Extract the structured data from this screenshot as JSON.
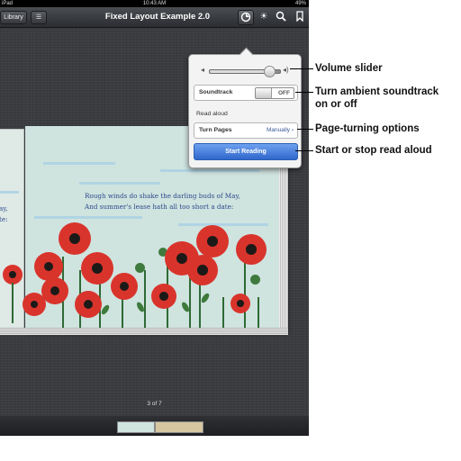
{
  "status_bar": {
    "device": "iPad",
    "wifi_icon": "wifi-icon",
    "time": "10:43 AM",
    "battery": "49%"
  },
  "toolbar": {
    "library_label": "Library",
    "toc_icon": "list-icon",
    "title": "Fixed Layout Example 2.0",
    "audio_icon": "audio-options-icon",
    "brightness_icon": "brightness-icon",
    "search_icon": "search-icon",
    "bookmark_icon": "bookmark-icon"
  },
  "page": {
    "poem_line1": "Rough winds do shake the darling buds of May,",
    "poem_line2": "And summer's lease hath all too short a date:",
    "left_page_fragment_1": "ay,",
    "left_page_fragment_2": "te:",
    "page_indicator": "3 of 7"
  },
  "popover": {
    "volume_level": 0.85,
    "soundtrack_label": "Soundtrack",
    "soundtrack_state": "OFF",
    "read_aloud_heading": "Read aloud",
    "turn_pages_label": "Turn Pages",
    "turn_pages_value": "Manually",
    "start_button": "Start Reading"
  },
  "callouts": {
    "volume": "Volume slider",
    "soundtrack_1": "Turn ambient soundtrack",
    "soundtrack_2": "on or off",
    "page_turning": "Page-turning options",
    "read_aloud": "Start or stop read aloud"
  },
  "colors": {
    "accent": "#2f67cc",
    "poppy": "#d9342c",
    "text_blue": "#2e4b8c"
  }
}
